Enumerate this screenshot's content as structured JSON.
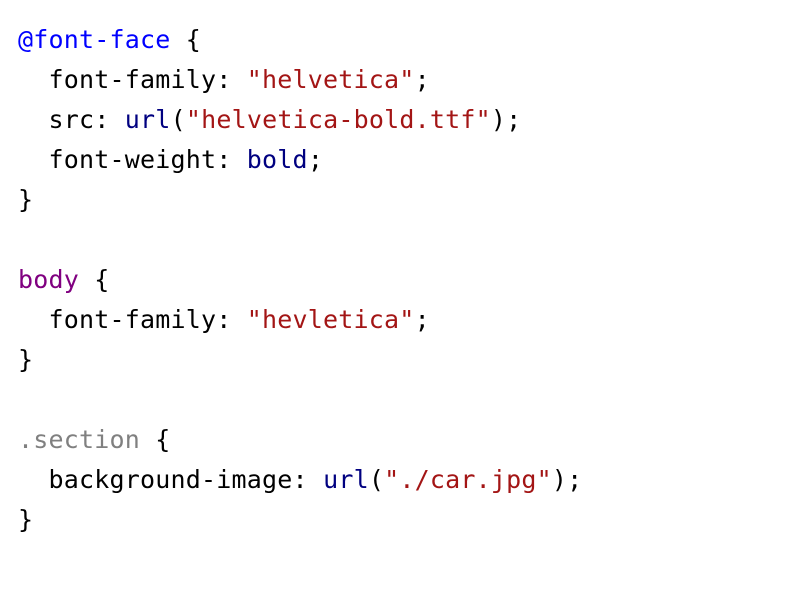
{
  "code": {
    "at_font_face": "@font-face",
    "open_brace": " {",
    "close_brace": "}",
    "indent": "  ",
    "font_family_prop": "font-family",
    "src_prop": "src",
    "font_weight_prop": "font-weight",
    "background_image_prop": "background-image",
    "url_func": "url",
    "colon_space": ": ",
    "semicolon": ";",
    "lparen": "(",
    "rparen": ")",
    "helvetica_str": "\"helvetica\"",
    "helvetica_bold_str": "\"helvetica-bold.ttf\"",
    "hevletica_str": "\"hevletica\"",
    "car_jpg_str": "\"./car.jpg\"",
    "bold_value": "bold",
    "body_selector": "body",
    "section_selector": ".section"
  }
}
